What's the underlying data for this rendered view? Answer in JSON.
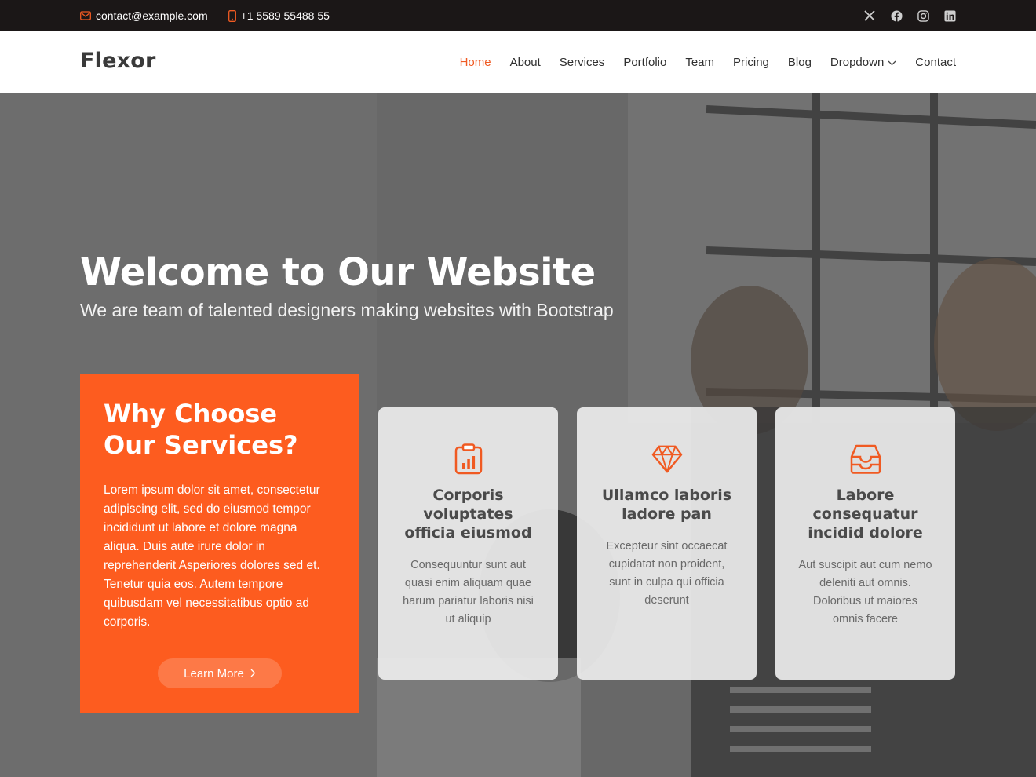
{
  "topbar": {
    "email": "contact@example.com",
    "phone": "+1 5589 55488 55",
    "social": [
      "x-icon",
      "facebook-icon",
      "instagram-icon",
      "linkedin-icon"
    ]
  },
  "header": {
    "logo": "Flexor",
    "nav": [
      "Home",
      "About",
      "Services",
      "Portfolio",
      "Team",
      "Pricing",
      "Blog",
      "Dropdown",
      "Contact"
    ],
    "active": "Home"
  },
  "hero": {
    "title": "Welcome to Our Website",
    "subtitle": "We are team of talented designers making websites with Bootstrap",
    "why": {
      "title": "Why Choose Our Services?",
      "text": "Lorem ipsum dolor sit amet, consectetur adipiscing elit, sed do eiusmod tempor incididunt ut labore et dolore magna aliqua. Duis aute irure dolor in reprehenderit Asperiores dolores sed et. Tenetur quia eos. Autem tempore quibusdam vel necessitatibus optio ad corporis.",
      "button": "Learn More"
    },
    "cards": [
      {
        "icon": "clipboard-data-icon",
        "title": "Corporis voluptates officia eiusmod",
        "text": "Consequuntur sunt aut quasi enim aliquam quae harum pariatur laboris nisi ut aliquip"
      },
      {
        "icon": "gem-icon",
        "title": "Ullamco laboris ladore pan",
        "text": "Excepteur sint occaecat cupidatat non proident, sunt in culpa qui officia deserunt"
      },
      {
        "icon": "inbox-icon",
        "title": "Labore consequatur incidid dolore",
        "text": "Aut suscipit aut cum nemo deleniti aut omnis. Doloribus ut maiores omnis facere"
      }
    ]
  },
  "colors": {
    "accent": "#fd5c1f",
    "topbar": "#1b1717",
    "nav_active": "#f05a22"
  }
}
